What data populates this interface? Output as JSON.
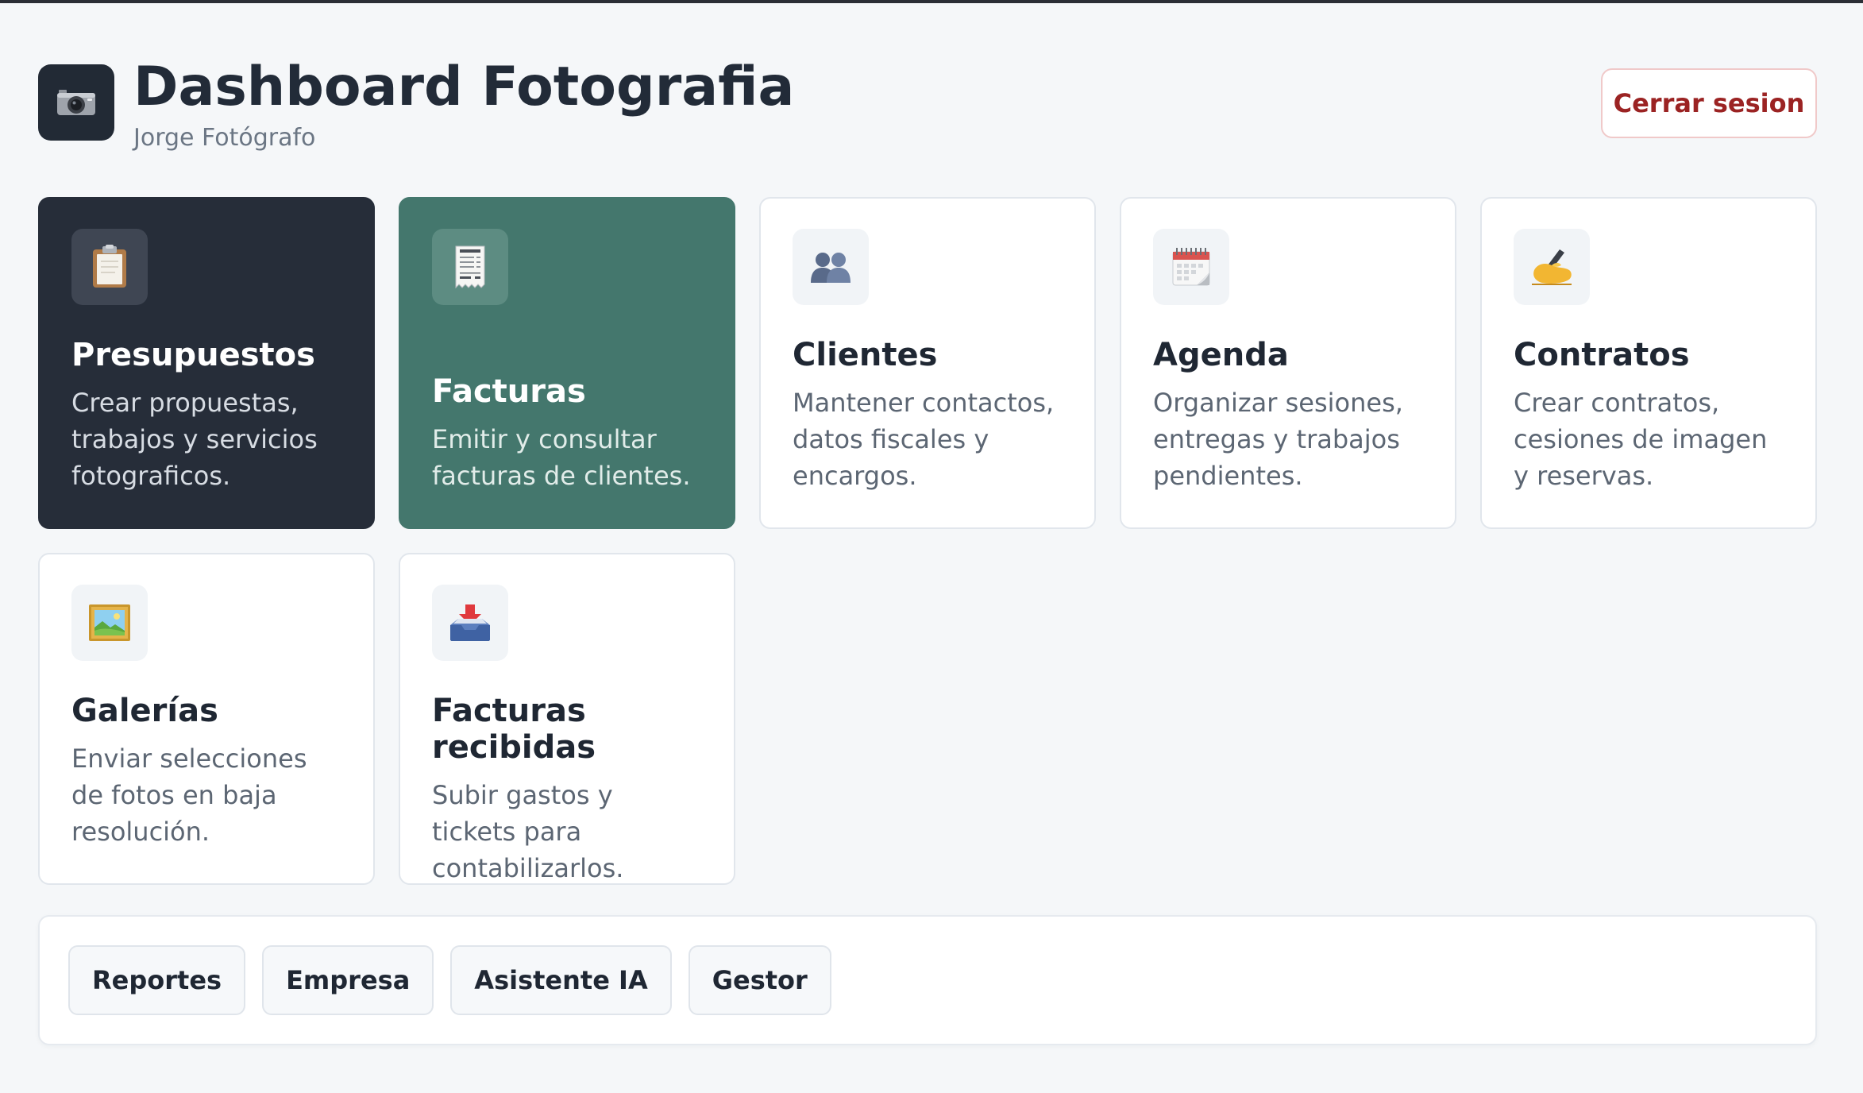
{
  "header": {
    "title": "Dashboard Fotografia",
    "subtitle": "Jorge Fotógrafo",
    "logout_label": "Cerrar sesion",
    "logo_icon": "camera-icon"
  },
  "modules": [
    {
      "icon": "clipboard-icon",
      "title": "Presupuestos",
      "description": "Crear propuestas, trabajos y servicios fotograficos.",
      "style": "dark"
    },
    {
      "icon": "receipt-icon",
      "title": "Facturas",
      "description": "Emitir y consultar facturas de clientes.",
      "style": "green"
    },
    {
      "icon": "people-icon",
      "title": "Clientes",
      "description": "Mantener contactos, datos fiscales y encargos.",
      "style": "light"
    },
    {
      "icon": "calendar-icon",
      "title": "Agenda",
      "description": "Organizar sesiones, entregas y trabajos pendientes.",
      "style": "light"
    },
    {
      "icon": "writing-hand-icon",
      "title": "Contratos",
      "description": "Crear contratos, cesiones de imagen y reservas.",
      "style": "light"
    },
    {
      "icon": "framed-picture-icon",
      "title": "Galerías",
      "description": "Enviar selecciones de fotos en baja resolución.",
      "style": "light"
    },
    {
      "icon": "inbox-tray-icon",
      "title": "Facturas recibidas",
      "description": "Subir gastos y tickets para contabilizarlos.",
      "style": "light"
    }
  ],
  "bottom_nav": [
    {
      "label": "Reportes"
    },
    {
      "label": "Empresa"
    },
    {
      "label": "Asistente IA"
    },
    {
      "label": "Gestor"
    }
  ],
  "colors": {
    "dark_card": "#262d39",
    "green_card": "#44776d",
    "logout_text": "#9b2323",
    "background": "#f5f7f9"
  }
}
